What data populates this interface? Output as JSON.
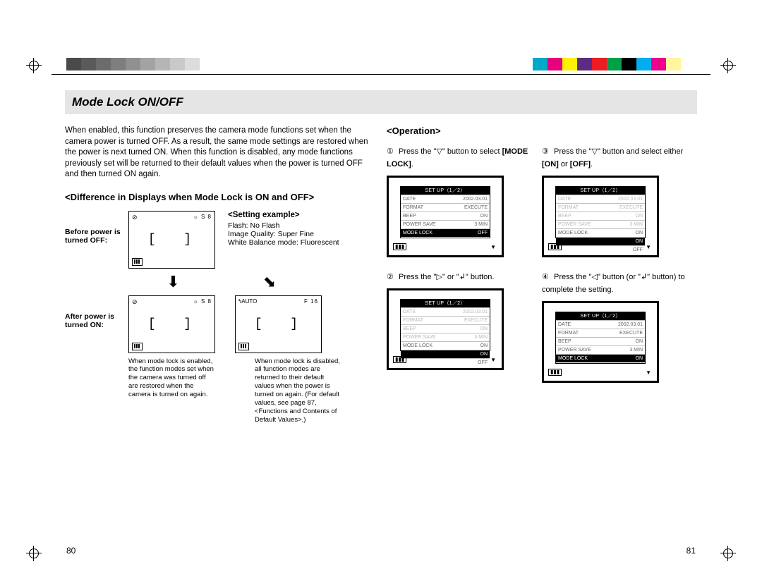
{
  "title": "Mode Lock ON/OFF",
  "intro": "When enabled, this function preserves the camera mode functions set when the camera power is turned OFF. As a result, the same mode settings are restored when the power is next turned ON. When this function is disabled, any mode functions previously set will be returned to their default values when the power is turned OFF and then turned ON again.",
  "diff_heading": "<Difference in Displays when Mode Lock is ON and OFF>",
  "before_label": "Before power is turned OFF:",
  "after_label": "After power is turned ON:",
  "setting_example": {
    "heading": "<Setting example>",
    "lines": [
      "Flash: No Flash",
      "Image Quality: Super Fine",
      "White Balance mode: Fluorescent"
    ]
  },
  "lcd_before": {
    "tl": "⊘",
    "tr": "☼ S 8"
  },
  "lcd_after_on": {
    "tl": "⊘",
    "tr": "☼ S 8"
  },
  "lcd_after_off": {
    "tl": "ϟAUTO",
    "tr": "F 16"
  },
  "caption_on": "When mode lock is enabled, the function modes set when the camera was turned off are restored when the camera is turned on again.",
  "caption_off": "When mode lock is disabled, all function modes are returned to their default values when the power is turned on again. (For default values, see page 87, <Functions and Contents of Default Values>.)",
  "operation_heading": "<Operation>",
  "steps": [
    {
      "n": "①",
      "text_pre": "Press the \"▽\" button to select ",
      "bold": "[MODE LOCK]",
      "text_post": "."
    },
    {
      "n": "③",
      "text_pre": "Press the \"▽\" button and select either ",
      "bold": "[ON]",
      "mid": " or ",
      "bold2": "[OFF]",
      "text_post": "."
    },
    {
      "n": "②",
      "text_pre": "Press the \"▷\" or \"↲\" button.",
      "bold": "",
      "text_post": ""
    },
    {
      "n": "④",
      "text_pre": "Press the \"◁\" button (or \"↲\" button) to complete the setting.",
      "bold": "",
      "text_post": ""
    }
  ],
  "menu": {
    "header": "SET UP（1／2）",
    "rows": [
      {
        "l": "DATE",
        "r": "2002.03.01"
      },
      {
        "l": "FORMAT",
        "r": "EXECUTE"
      },
      {
        "l": "BEEP",
        "r": "ON"
      },
      {
        "l": "POWER SAVE",
        "r": "3 MIN"
      },
      {
        "l": "MODE LOCK",
        "r": "OFF"
      }
    ],
    "rows_on": [
      {
        "l": "ON",
        "r": ""
      },
      {
        "l": "OFF",
        "r": ""
      }
    ]
  },
  "page_left": "80",
  "page_right": "81",
  "swatches_left": [
    "#4a4a4a",
    "#5a5a5a",
    "#6c6c6c",
    "#7e7e7e",
    "#909090",
    "#a3a3a3",
    "#b6b6b6",
    "#c9c9c9",
    "#dcdcdc",
    "#ffffff"
  ],
  "swatches_right": [
    "#00a9c7",
    "#e6007e",
    "#fff200",
    "#5a2d82",
    "#ec1c24",
    "#00a04b",
    "#000000",
    "#00adee",
    "#ec008c",
    "#fff69f",
    "#ffffff"
  ]
}
